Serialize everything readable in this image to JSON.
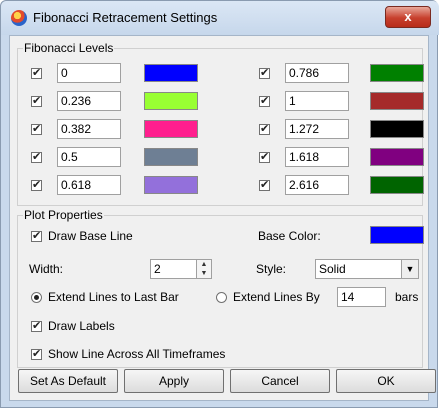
{
  "window": {
    "title": "Fibonacci Retracement Settings",
    "close_glyph": "x"
  },
  "fib": {
    "legend": "Fibonacci Levels",
    "left": [
      {
        "value": "0",
        "color": "#0000ff"
      },
      {
        "value": "0.236",
        "color": "#99ff33"
      },
      {
        "value": "0.382",
        "color": "#ff1f8e"
      },
      {
        "value": "0.5",
        "color": "#6e7f94"
      },
      {
        "value": "0.618",
        "color": "#9370db"
      }
    ],
    "right": [
      {
        "value": "0.786",
        "color": "#008000"
      },
      {
        "value": "1",
        "color": "#a52a2a"
      },
      {
        "value": "1.272",
        "color": "#000000"
      },
      {
        "value": "1.618",
        "color": "#800080"
      },
      {
        "value": "2.616",
        "color": "#006400"
      }
    ]
  },
  "plot": {
    "legend": "Plot Properties",
    "draw_base_line": "Draw Base Line",
    "base_color_label": "Base Color:",
    "base_color": "#0000ff",
    "width_label": "Width:",
    "width_value": "2",
    "style_label": "Style:",
    "style_value": "Solid",
    "extend_last_bar": "Extend Lines to Last Bar",
    "extend_by": "Extend Lines By",
    "extend_by_value": "14",
    "bars_label": "bars",
    "draw_labels": "Draw Labels",
    "show_all_tf": "Show Line Across All Timeframes"
  },
  "buttons": {
    "set_default": "Set As Default",
    "apply": "Apply",
    "cancel": "Cancel",
    "ok": "OK"
  }
}
